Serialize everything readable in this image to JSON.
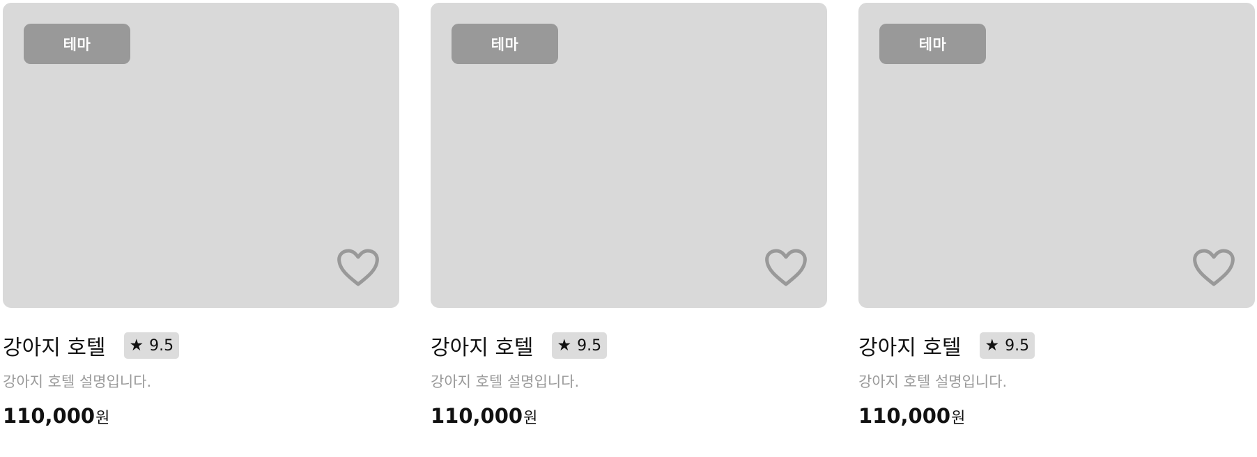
{
  "colors": {
    "thumbnail_bg": "#d9d9d9",
    "tag_bg": "#999999",
    "tag_text": "#ffffff",
    "heart_stroke": "#999999",
    "rating_bg": "#dcdcdc",
    "description_text": "#9a9a9a",
    "title_text": "#111111"
  },
  "cards": [
    {
      "tag": "테마",
      "favorite_icon": "heart-outline-icon",
      "title": "강아지 호텔",
      "rating_icon": "★",
      "rating": "9.5",
      "description": "강아지 호텔 설명입니다.",
      "price": "110,000",
      "price_unit": "원"
    },
    {
      "tag": "테마",
      "favorite_icon": "heart-outline-icon",
      "title": "강아지 호텔",
      "rating_icon": "★",
      "rating": "9.5",
      "description": "강아지 호텔 설명입니다.",
      "price": "110,000",
      "price_unit": "원"
    },
    {
      "tag": "테마",
      "favorite_icon": "heart-outline-icon",
      "title": "강아지 호텔",
      "rating_icon": "★",
      "rating": "9.5",
      "description": "강아지 호텔 설명입니다.",
      "price": "110,000",
      "price_unit": "원"
    }
  ]
}
